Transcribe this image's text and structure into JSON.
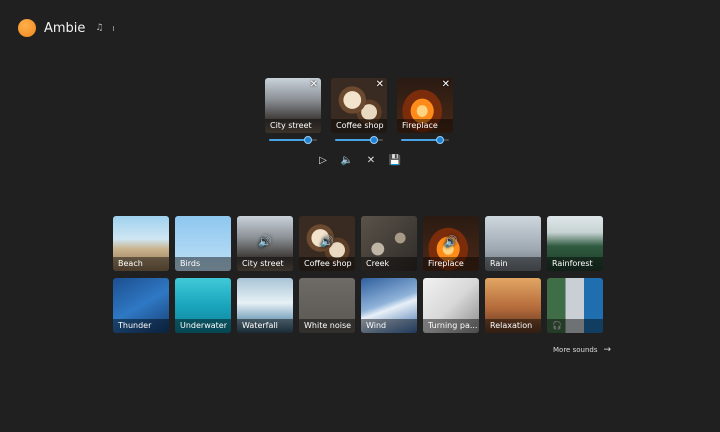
{
  "app": {
    "title": "Ambie"
  },
  "active": [
    {
      "label": "City street",
      "img": "img-city",
      "volume": 0.82
    },
    {
      "label": "Coffee shop",
      "img": "img-coffee",
      "volume": 0.82
    },
    {
      "label": "Fireplace",
      "img": "img-fire",
      "volume": 0.82
    }
  ],
  "sounds": [
    {
      "label": "Beach",
      "img": "img-beach",
      "playing": false
    },
    {
      "label": "Birds",
      "img": "img-birds",
      "playing": false
    },
    {
      "label": "City street",
      "img": "img-city",
      "playing": true
    },
    {
      "label": "Coffee shop",
      "img": "img-coffee",
      "playing": true
    },
    {
      "label": "Creek",
      "img": "img-creek",
      "playing": false
    },
    {
      "label": "Fireplace",
      "img": "img-fire",
      "playing": true
    },
    {
      "label": "Rain",
      "img": "img-rain",
      "playing": false
    },
    {
      "label": "Rainforest",
      "img": "img-rainforest",
      "playing": false
    },
    {
      "label": "Thunder",
      "img": "img-thunder",
      "playing": false
    },
    {
      "label": "Underwater",
      "img": "img-underwater",
      "playing": false
    },
    {
      "label": "Waterfall",
      "img": "img-waterfall",
      "playing": false
    },
    {
      "label": "White noise",
      "img": "img-whitenoise",
      "playing": false
    },
    {
      "label": "Wind",
      "img": "img-wind",
      "playing": false
    },
    {
      "label": "Turning pa...",
      "img": "img-turning",
      "playing": false
    },
    {
      "label": "Relaxation",
      "img": "img-relax",
      "playing": false
    },
    {
      "label": "",
      "img": "img-mix",
      "playing": false,
      "headphones": true
    }
  ],
  "more_sounds": {
    "label": "More sounds"
  },
  "icons": {
    "play": "▷",
    "volume": "🔈",
    "clear": "✕",
    "save": "💾",
    "close": "✕",
    "speaker": "🔊",
    "arrow": "→",
    "note": "♫",
    "headphones": "🎧"
  },
  "colors": {
    "accent": "#1f84d6",
    "background": "#202020"
  }
}
